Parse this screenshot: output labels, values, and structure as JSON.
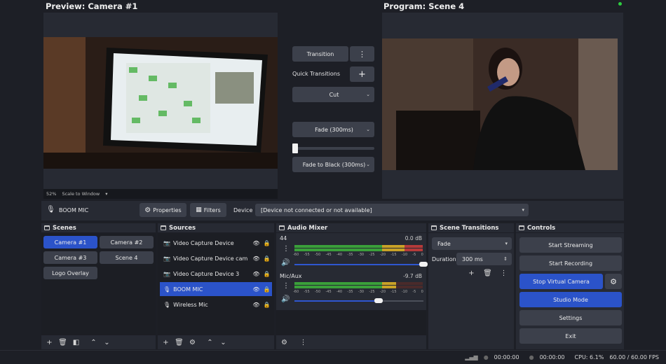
{
  "preview": {
    "title": "Preview: Camera #1",
    "zoom": "52%",
    "scale_mode": "Scale to Window"
  },
  "program": {
    "title": "Program: Scene 4"
  },
  "transitions": {
    "transition_label": "Transition",
    "quick_label": "Quick Transitions",
    "items": [
      "Cut",
      "Fade (300ms)",
      "Fade to Black (300ms)"
    ],
    "tbar_level": 0.0
  },
  "source_toolbar": {
    "selected_source": "BOOM MIC",
    "properties_label": "Properties",
    "filters_label": "Filters",
    "device_label": "Device",
    "device_value": "[Device not connected or not available]"
  },
  "scenes": {
    "title": "Scenes",
    "items": [
      "Camera #1",
      "Camera #2",
      "Camera #3",
      "Scene 4",
      "Logo Overlay"
    ],
    "active": "Camera #1"
  },
  "sources": {
    "title": "Sources",
    "items": [
      "Video Capture Device",
      "Video Capture Device cam",
      "Video Capture Device 3",
      "BOOM MIC",
      "Wireless Mic"
    ],
    "active": "BOOM MIC"
  },
  "audio_mixer": {
    "title": "Audio Mixer",
    "ticks": [
      "-60",
      "-55",
      "-50",
      "-45",
      "-40",
      "-35",
      "-30",
      "-25",
      "-20",
      "-15",
      "-10",
      "-5",
      "0"
    ],
    "channels": [
      {
        "name": "44",
        "db": "0.0 dB",
        "volume": 1.0
      },
      {
        "name": "Mic/Aux",
        "db": "-9.7 dB",
        "volume": 0.65
      }
    ]
  },
  "scene_transitions": {
    "title": "Scene Transitions",
    "transition": "Fade",
    "duration_label": "Duration",
    "duration_value": "300 ms"
  },
  "controls": {
    "title": "Controls",
    "start_streaming": "Start Streaming",
    "start_recording": "Start Recording",
    "stop_virtual_camera": "Stop Virtual Camera",
    "studio_mode": "Studio Mode",
    "settings": "Settings",
    "exit": "Exit"
  },
  "status": {
    "stream_time": "00:00:00",
    "record_time": "00:00:00",
    "cpu": "CPU: 6.1%",
    "fps": "60.00 / 60.00 FPS"
  },
  "colors": {
    "accent": "#2b53c9",
    "meter_green": "#3aa03a",
    "meter_yellow": "#c9a227",
    "meter_red": "#b53a3a",
    "live_dot": "#2ecc40"
  }
}
